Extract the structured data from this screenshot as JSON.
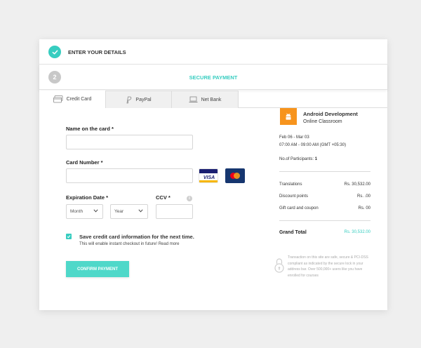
{
  "steps": {
    "step1": {
      "title": "ENTER YOUR DETAILS"
    },
    "step2": {
      "number": "2",
      "title": "SECURE PAYMENT"
    }
  },
  "tabs": [
    {
      "label": "Credit Card",
      "icon": "credit-card-icon"
    },
    {
      "label": "PayPal",
      "icon": "paypal-icon"
    },
    {
      "label": "Net Bank",
      "icon": "laptop-icon"
    }
  ],
  "form": {
    "name_label": "Name on the card *",
    "card_number_label": "Card Number *",
    "expiration_label": "Expiration Date *",
    "month_placeholder": "Month",
    "year_placeholder": "Year",
    "ccv_label": "CCV *",
    "info_glyph": "i",
    "save_label": "Save credit card information for the next time.",
    "save_sub": "This will enable instant checkout in future! Read more",
    "confirm_label": "CONFIRM PAYMENT"
  },
  "summary": {
    "course_title": "Android Development",
    "course_sub": "Online Classroom",
    "dates": "Feb 06 - Mar 03",
    "time": "07:00 AM - 09:00 AM (GMT +05:30)",
    "participants_label": "No.of Participants:",
    "participants_value": "1",
    "rows": [
      {
        "label": "Translations",
        "value": "Rs. 30,532.00"
      },
      {
        "label": "Discount points",
        "value": "Rs. .00"
      },
      {
        "label": "Gift card and coupon",
        "value": "Rs. 00"
      }
    ],
    "grand_total_label": "Grand Total",
    "grand_total_value": "Rs. 30,532.00",
    "secure_note": "Transaction on this site are safe, secure & PCI-DSS compliant as indicated by the secure lock in your address bar. Over 500,000+ users like you have enrolled for courses"
  },
  "colors": {
    "accent": "#37cdc0",
    "confirm": "#4fd8c9",
    "course": "#f7941d",
    "visa_blue": "#1a1f71",
    "mastercard_bg": "#16366f"
  }
}
